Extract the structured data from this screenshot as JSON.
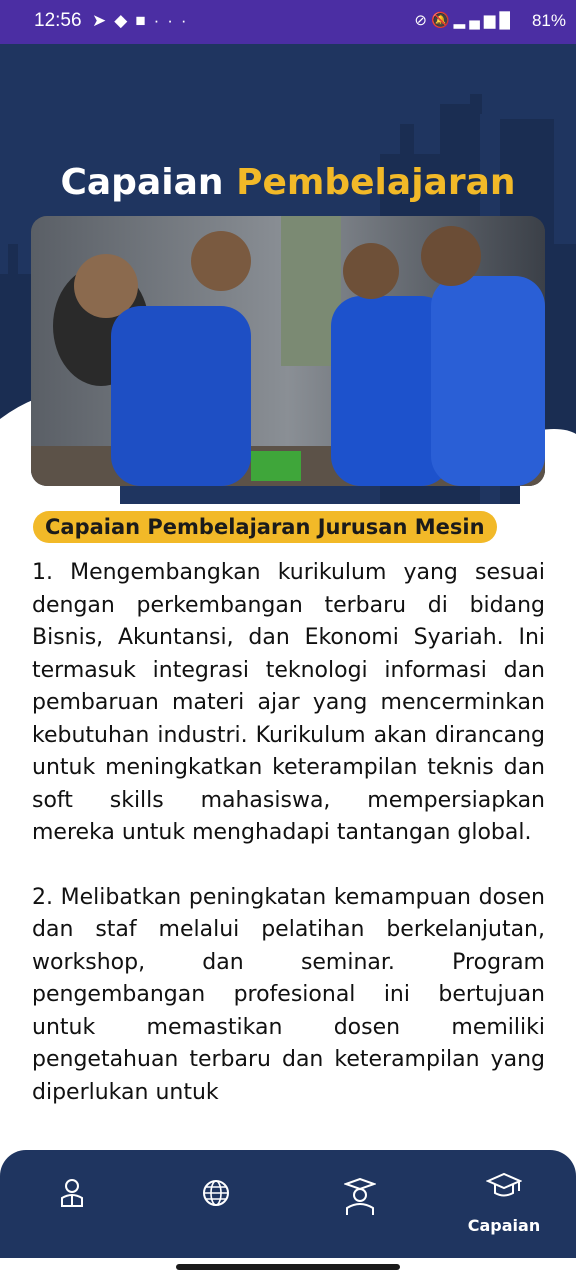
{
  "status_bar": {
    "time": "12:56",
    "left_icons": [
      "telegram-icon",
      "diamond-icon",
      "square-icon",
      "more-icon"
    ],
    "right_icons": [
      "link-icon",
      "mute-icon",
      "volte-icon",
      "4g-icon",
      "signal-icon",
      "signal-icon"
    ],
    "battery": "81%"
  },
  "header": {
    "title_part1": "Capaian",
    "title_part2": "Pembelajaran",
    "accent_color": "#f2b928",
    "background_color": "#1f3560"
  },
  "section": {
    "badge": "Capaian Pembelajaran Jurusan Mesin",
    "paragraphs": [
      "1. Mengembangkan kurikulum yang sesuai dengan perkembangan terbaru di bidang Bisnis, Akuntansi, dan Ekonomi Syariah. Ini termasuk integrasi teknologi informasi dan pembaruan materi ajar yang mencerminkan kebutuhan industri. Kurikulum akan dirancang untuk meningkatkan keterampilan teknis dan soft skills mahasiswa, mempersiapkan mereka untuk menghadapi tantangan global.",
      "2. Melibatkan peningkatan kemampuan dosen dan staf melalui pelatihan berkelanjutan, workshop, dan seminar. Program pengembangan profesional ini bertujuan untuk memastikan dosen memiliki pengetahuan terbaru dan keterampilan yang diperlukan untuk"
    ]
  },
  "bottom_nav": {
    "items": [
      {
        "icon": "student-reading-icon",
        "label": ""
      },
      {
        "icon": "globe-icon",
        "label": ""
      },
      {
        "icon": "graduate-icon",
        "label": ""
      },
      {
        "icon": "graduation-cap-icon",
        "label": "Capaian"
      }
    ]
  }
}
